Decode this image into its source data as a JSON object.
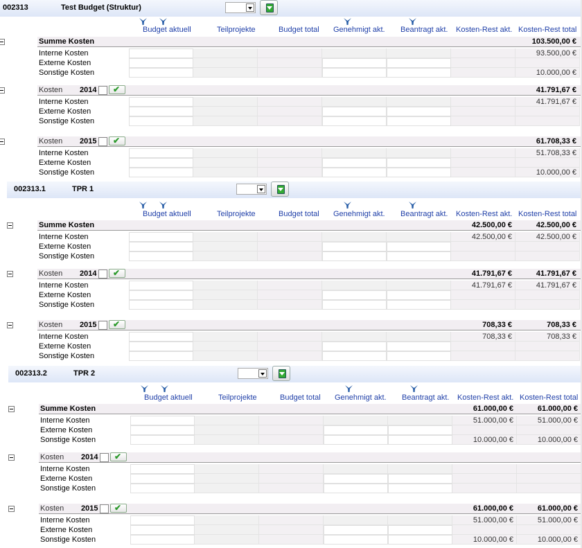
{
  "columns": [
    "Budget aktuell",
    "Teilprojekte",
    "Budget total",
    "Genehmigt akt.",
    "Beantragt akt.",
    "Kosten-Rest akt.",
    "Kosten-Rest total"
  ],
  "labels": {
    "summe": "Summe Kosten",
    "kosten": "Kosten",
    "interne": "Interne Kosten",
    "externe": "Externe Kosten",
    "sonstige": "Sonstige Kosten"
  },
  "projects": [
    {
      "id": "002313",
      "name": "Test Budget (Struktur)",
      "summe": {
        "rest_akt": "",
        "rest_total": "103.500,00 €",
        "rows": [
          {
            "rest_akt": "",
            "rest_total": "93.500,00 €"
          },
          {
            "rest_akt": "",
            "rest_total": ""
          },
          {
            "rest_akt": "",
            "rest_total": "10.000,00 €"
          }
        ]
      },
      "years": [
        {
          "year": "2014",
          "rest_akt": "",
          "rest_total": "41.791,67 €",
          "rows": [
            {
              "rest_akt": "",
              "rest_total": "41.791,67 €"
            },
            {
              "rest_akt": "",
              "rest_total": ""
            },
            {
              "rest_akt": "",
              "rest_total": ""
            }
          ]
        },
        {
          "year": "2015",
          "rest_akt": "",
          "rest_total": "61.708,33 €",
          "rows": [
            {
              "rest_akt": "",
              "rest_total": "51.708,33 €"
            },
            {
              "rest_akt": "",
              "rest_total": ""
            },
            {
              "rest_akt": "",
              "rest_total": "10.000,00 €"
            }
          ]
        }
      ]
    },
    {
      "id": "002313.1",
      "name": "TPR 1",
      "summe": {
        "rest_akt": "42.500,00 €",
        "rest_total": "42.500,00 €",
        "rows": [
          {
            "rest_akt": "42.500,00 €",
            "rest_total": "42.500,00 €"
          },
          {
            "rest_akt": "",
            "rest_total": ""
          },
          {
            "rest_akt": "",
            "rest_total": ""
          }
        ]
      },
      "years": [
        {
          "year": "2014",
          "rest_akt": "41.791,67 €",
          "rest_total": "41.791,67 €",
          "rows": [
            {
              "rest_akt": "41.791,67 €",
              "rest_total": "41.791,67 €"
            },
            {
              "rest_akt": "",
              "rest_total": ""
            },
            {
              "rest_akt": "",
              "rest_total": ""
            }
          ]
        },
        {
          "year": "2015",
          "rest_akt": "708,33 €",
          "rest_total": "708,33 €",
          "rows": [
            {
              "rest_akt": "708,33 €",
              "rest_total": "708,33 €"
            },
            {
              "rest_akt": "",
              "rest_total": ""
            },
            {
              "rest_akt": "",
              "rest_total": ""
            }
          ]
        }
      ]
    },
    {
      "id": "002313.2",
      "name": "TPR 2",
      "summe": {
        "rest_akt": "61.000,00 €",
        "rest_total": "61.000,00 €",
        "rows": [
          {
            "rest_akt": "51.000,00 €",
            "rest_total": "51.000,00 €"
          },
          {
            "rest_akt": "",
            "rest_total": ""
          },
          {
            "rest_akt": "10.000,00 €",
            "rest_total": "10.000,00 €"
          }
        ]
      },
      "years": [
        {
          "year": "2014",
          "rest_akt": "",
          "rest_total": "",
          "rows": [
            {
              "rest_akt": "",
              "rest_total": ""
            },
            {
              "rest_akt": "",
              "rest_total": ""
            },
            {
              "rest_akt": "",
              "rest_total": ""
            }
          ]
        },
        {
          "year": "2015",
          "rest_akt": "61.000,00 €",
          "rest_total": "61.000,00 €",
          "rows": [
            {
              "rest_akt": "51.000,00 €",
              "rest_total": "51.000,00 €"
            },
            {
              "rest_akt": "",
              "rest_total": ""
            },
            {
              "rest_akt": "10.000,00 €",
              "rest_total": "10.000,00 €"
            }
          ]
        }
      ]
    }
  ]
}
